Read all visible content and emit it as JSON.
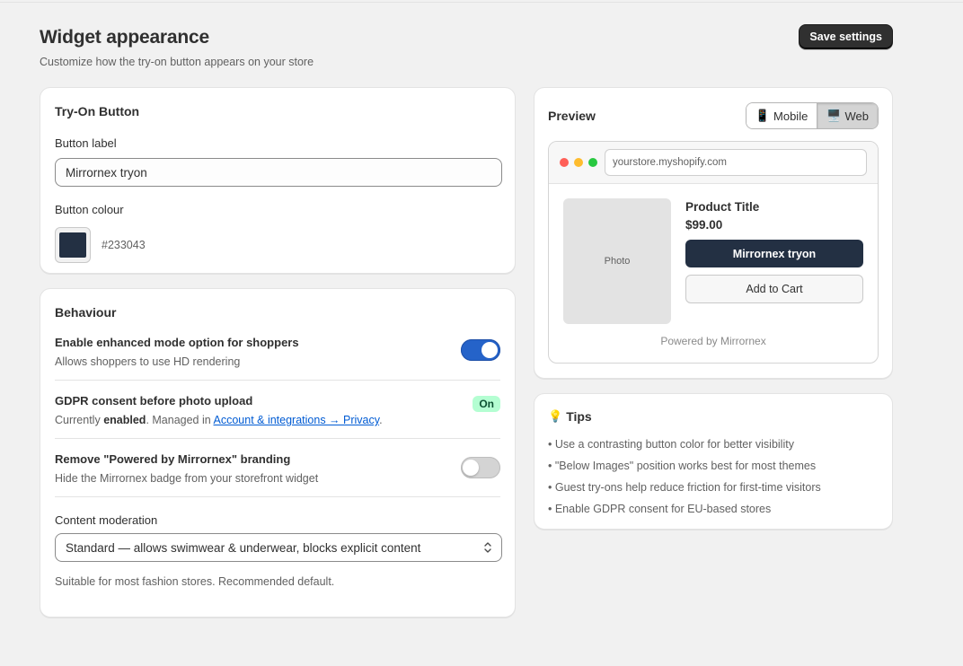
{
  "header": {
    "title": "Widget appearance",
    "subtitle": "Customize how the try-on button appears on your store",
    "save_label": "Save settings"
  },
  "tryon_card": {
    "title": "Try-On Button",
    "label_field": {
      "label": "Button label",
      "value": "Mirrornex tryon"
    },
    "colour_field": {
      "label": "Button colour",
      "value": "#233043"
    }
  },
  "behaviour_card": {
    "title": "Behaviour",
    "enhanced": {
      "title": "Enable enhanced mode option for shoppers",
      "description": "Allows shoppers to use HD rendering",
      "enabled": true
    },
    "gdpr": {
      "title": "GDPR consent before photo upload",
      "desc_prefix": "Currently ",
      "desc_status": "enabled",
      "desc_middle": ". Managed in ",
      "desc_link": "Account & integrations → Privacy",
      "desc_suffix": ".",
      "badge": "On"
    },
    "branding": {
      "title": "Remove \"Powered by Mirrornex\" branding",
      "description": "Hide the Mirrornex badge from your storefront widget",
      "enabled": false
    },
    "moderation": {
      "label": "Content moderation",
      "selected": "Standard — allows swimwear & underwear, blocks explicit content",
      "help": "Suitable for most fashion stores. Recommended default."
    }
  },
  "preview_card": {
    "title": "Preview",
    "segments": [
      {
        "icon": "📱",
        "label": "Mobile",
        "active": false
      },
      {
        "icon": "🖥️",
        "label": "Web",
        "active": true
      }
    ],
    "browser": {
      "url": "yourstore.myshopify.com",
      "dots": [
        "#ff5f57",
        "#febc2e",
        "#28c840"
      ]
    },
    "product": {
      "photo_label": "Photo",
      "title": "Product Title",
      "price": "$99.00",
      "tryon_label": "Mirrornex tryon",
      "cart_label": "Add to Cart",
      "powered": "Powered by Mirrornex"
    }
  },
  "tips_card": {
    "icon": "💡",
    "title": "Tips",
    "items": [
      "• Use a contrasting button color for better visibility",
      "• \"Below Images\" position works best for most themes",
      "• Guest try-ons help reduce friction for first-time visitors",
      "• Enable GDPR consent for EU-based stores"
    ]
  }
}
